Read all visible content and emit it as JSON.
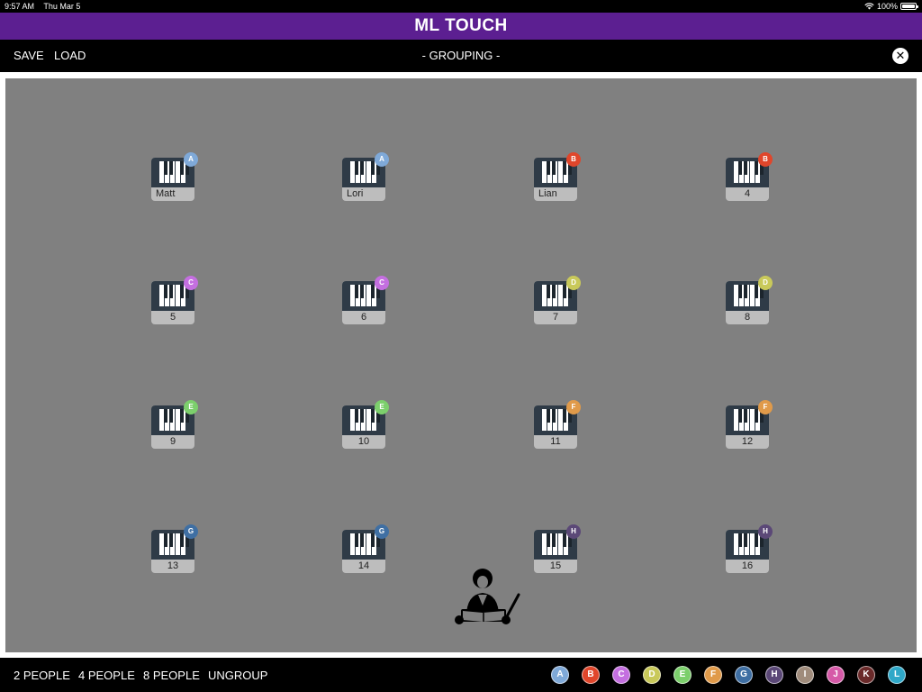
{
  "status": {
    "time": "9:57 AM",
    "date": "Thu Mar 5",
    "battery": "100%"
  },
  "app": {
    "title": "ML TOUCH"
  },
  "toolbar": {
    "save_label": "SAVE",
    "load_label": "LOAD",
    "mode_label": "- GROUPING -",
    "close_icon": "close-icon"
  },
  "stations": [
    {
      "label": "Matt",
      "group": "A",
      "align": "left"
    },
    {
      "label": "Lori",
      "group": "A",
      "align": "left"
    },
    {
      "label": "Lian",
      "group": "B",
      "align": "left"
    },
    {
      "label": "4",
      "group": "B",
      "align": "center"
    },
    {
      "label": "5",
      "group": "C",
      "align": "center"
    },
    {
      "label": "6",
      "group": "C",
      "align": "center"
    },
    {
      "label": "7",
      "group": "D",
      "align": "center"
    },
    {
      "label": "8",
      "group": "D",
      "align": "center"
    },
    {
      "label": "9",
      "group": "E",
      "align": "center"
    },
    {
      "label": "10",
      "group": "E",
      "align": "center"
    },
    {
      "label": "11",
      "group": "F",
      "align": "center"
    },
    {
      "label": "12",
      "group": "F",
      "align": "center"
    },
    {
      "label": "13",
      "group": "G",
      "align": "center"
    },
    {
      "label": "14",
      "group": "G",
      "align": "center"
    },
    {
      "label": "15",
      "group": "H",
      "align": "center"
    },
    {
      "label": "16",
      "group": "H",
      "align": "center"
    }
  ],
  "group_colors": {
    "A": "#7fa9d8",
    "B": "#e0462b",
    "C": "#c46fe0",
    "D": "#c9c95a",
    "E": "#7ccf6c",
    "F": "#e09a4a",
    "G": "#3f6fa3",
    "H": "#5b4877",
    "I": "#a08c7c",
    "J": "#d65aa8",
    "K": "#6a2a2a",
    "L": "#2fa8c8"
  },
  "bottom": {
    "two_people": "2 PEOPLE",
    "four_people": "4 PEOPLE",
    "eight_people": "8 PEOPLE",
    "ungroup": "UNGROUP",
    "groups": [
      "A",
      "B",
      "C",
      "D",
      "E",
      "F",
      "G",
      "H",
      "I",
      "J",
      "K",
      "L"
    ]
  },
  "conductor_icon": "conductor-icon"
}
